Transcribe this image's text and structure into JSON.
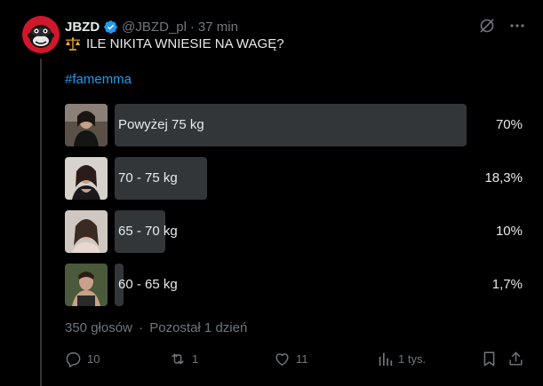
{
  "tweet": {
    "author_name": "JBZD",
    "handle": "@JBZD_pl",
    "separator": "·",
    "time": "37 min",
    "text": "ILE NIKITA WNIESIE NA WAGĘ?",
    "hashtag": "#famemma"
  },
  "poll": {
    "options": [
      {
        "label": "Powyżej 75 kg",
        "percent_text": "70%",
        "percent": 70
      },
      {
        "label": "70 - 75 kg",
        "percent_text": "18,3%",
        "percent": 18.3
      },
      {
        "label": "65 - 70 kg",
        "percent_text": "10%",
        "percent": 10
      },
      {
        "label": "60 - 65 kg",
        "percent_text": "1,7%",
        "percent": 1.7
      }
    ],
    "votes": "350 głosów",
    "meta_separator": "·",
    "remaining": "Pozostał 1 dzień"
  },
  "actions": {
    "replies": "10",
    "reposts": "1",
    "likes": "11",
    "views": "1 tys."
  },
  "icons": {
    "verified": "verified-badge-icon",
    "grok": "grok-icon",
    "more": "more-icon",
    "scales": "scales-emoji-icon",
    "reply": "reply-icon",
    "repost": "repost-icon",
    "like": "like-icon",
    "views": "views-icon",
    "bookmark": "bookmark-icon",
    "share": "share-icon"
  },
  "colors": {
    "background": "#000000",
    "text": "#e7e9ea",
    "muted": "#71767b",
    "accent": "#1d9bf0",
    "poll_bar": "#333639",
    "avatar": "#d0182c"
  }
}
